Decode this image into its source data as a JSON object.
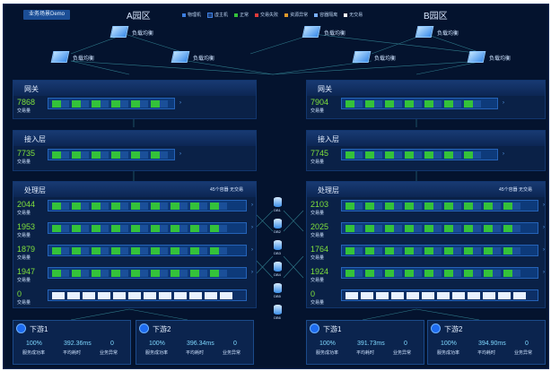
{
  "header": {
    "badge": "业务场景Demo",
    "zoneA": "A园区",
    "zoneB": "B园区",
    "legend": [
      {
        "label": "物理机",
        "color": "#3d7fe0"
      },
      {
        "label": "虚主机",
        "color": "#1e3f77"
      },
      {
        "label": "正常",
        "color": "#34c23a"
      },
      {
        "label": "交易失败",
        "color": "#e23b3b"
      },
      {
        "label": "资源异常",
        "color": "#e09a2a"
      },
      {
        "label": "容器隔离",
        "color": "#7ab0ff"
      },
      {
        "label": "无交易",
        "color": "#ffffff"
      }
    ]
  },
  "loadbalancers": {
    "label": "负载均衡"
  },
  "a": {
    "gateway": {
      "title": "网关",
      "rows": [
        {
          "value": "7868",
          "label": "交易量"
        }
      ]
    },
    "access": {
      "title": "接入层",
      "rows": [
        {
          "value": "7735",
          "label": "交易量"
        }
      ]
    },
    "process": {
      "title": "处理层",
      "note": "45个容器 无交易",
      "rows": [
        {
          "value": "2044",
          "label": "交易量"
        },
        {
          "value": "1953",
          "label": "交易量"
        },
        {
          "value": "1879",
          "label": "交易量"
        },
        {
          "value": "1947",
          "label": "交易量"
        },
        {
          "value": "0",
          "label": "交易量"
        }
      ]
    },
    "downstream": [
      {
        "name": "下游1",
        "rate": "100%",
        "time": "392.36ms",
        "err": "0",
        "rate_label": "服务成功率",
        "time_label": "平均耗时",
        "err_label": "业务异常"
      },
      {
        "name": "下游2",
        "rate": "100%",
        "time": "396.34ms",
        "err": "0",
        "rate_label": "服务成功率",
        "time_label": "平均耗时",
        "err_label": "业务异常"
      }
    ]
  },
  "b": {
    "gateway": {
      "title": "网关",
      "rows": [
        {
          "value": "7904",
          "label": "交易量"
        }
      ]
    },
    "access": {
      "title": "接入层",
      "rows": [
        {
          "value": "7745",
          "label": "交易量"
        }
      ]
    },
    "process": {
      "title": "处理层",
      "note": "45个容器 无交易",
      "rows": [
        {
          "value": "2103",
          "label": "交易量"
        },
        {
          "value": "2025",
          "label": "交易量"
        },
        {
          "value": "1764",
          "label": "交易量"
        },
        {
          "value": "1924",
          "label": "交易量"
        },
        {
          "value": "0",
          "label": "交易量"
        }
      ]
    },
    "downstream": [
      {
        "name": "下游1",
        "rate": "100%",
        "time": "391.73ms",
        "err": "0",
        "rate_label": "服务成功率",
        "time_label": "平均耗时",
        "err_label": "业务异常"
      },
      {
        "name": "下游2",
        "rate": "100%",
        "time": "394.90ms",
        "err": "0",
        "rate_label": "服务成功率",
        "time_label": "平均耗时",
        "err_label": "业务异常"
      }
    ]
  },
  "dbs": [
    "DB1",
    "DB2",
    "DB3",
    "DB4",
    "DB5",
    "DB6"
  ]
}
